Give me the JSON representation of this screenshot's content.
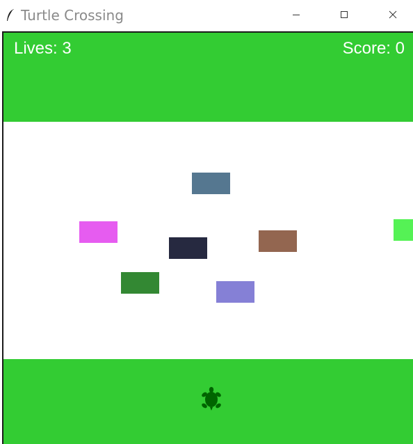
{
  "window": {
    "title": "Turtle Crossing",
    "icon": "feather-icon",
    "controls": [
      "minimize-icon",
      "maximize-icon",
      "close-icon"
    ]
  },
  "colors": {
    "grass": "#33cc33",
    "road": "#ffffff",
    "hud_text": "#ffffff",
    "turtle": "#006400"
  },
  "hud": {
    "lives_text": "Lives: 3",
    "score_text": "Score: 0"
  },
  "cars": [
    {
      "color": "#557790"
    },
    {
      "color": "#e65cf0"
    },
    {
      "color": "#262940"
    },
    {
      "color": "#936650"
    },
    {
      "color": "#55f255"
    },
    {
      "color": "#338833"
    },
    {
      "color": "#8580d6"
    }
  ],
  "player": {
    "icon": "turtle-icon"
  }
}
